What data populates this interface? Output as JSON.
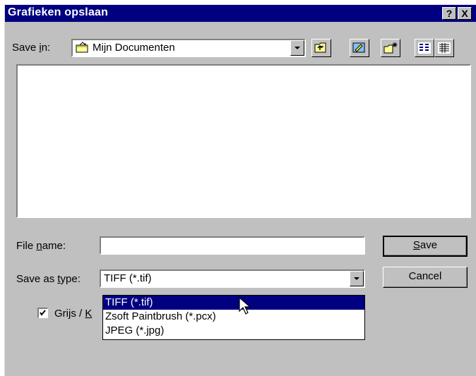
{
  "window": {
    "title": "Grafieken opslaan",
    "help_label": "?",
    "close_label": "X"
  },
  "save_in": {
    "label_pre": "Save ",
    "label_key": "i",
    "label_post": "n:",
    "value": "Mijn Documenten",
    "icon": "folder-icon"
  },
  "toolbar": {
    "buttons": [
      "up-one-level-icon",
      "desktop-icon",
      "new-folder-icon",
      "list-view-icon",
      "details-view-icon"
    ]
  },
  "file_name": {
    "label_pre": "File ",
    "label_key": "n",
    "label_post": "ame:",
    "value": ""
  },
  "save_as_type": {
    "label_pre": "Save as ",
    "label_key": "t",
    "label_post": "ype:",
    "value": "TIFF (*.tif)",
    "options": [
      "TIFF (*.tif)",
      "Zsoft Paintbrush (*.pcx)",
      "JPEG (*.jpg)"
    ],
    "selected_index": 0
  },
  "buttons": {
    "save_key": "S",
    "save_rest": "ave",
    "cancel": "Cancel"
  },
  "checkbox": {
    "checked": true,
    "label_pre": "Grijs / ",
    "label_key": "K"
  },
  "colors": {
    "title_bar": "#000080",
    "face": "#c0c0c0",
    "selection": "#000080"
  }
}
